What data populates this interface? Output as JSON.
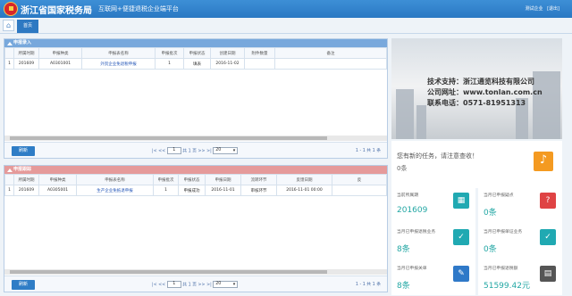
{
  "header": {
    "title": "浙江省国家税务局",
    "subtitle": "互联网+便捷退税企业端平台",
    "user": "测试企业",
    "logout": "[退出]"
  },
  "tabs": {
    "home": "⌂",
    "active": "首页"
  },
  "panel1": {
    "title": "申报录入",
    "columns": [
      "",
      "所属时期",
      "申报种类",
      "申报表名称",
      "申报批次",
      "申报状态",
      "创建日期",
      "附件数量",
      "备注"
    ],
    "rows": [
      [
        "1",
        "201609",
        "A0301001",
        "外贸企业免退税申报",
        "1",
        "填表",
        "2016-11-02",
        "",
        ""
      ]
    ],
    "refresh": "刷新",
    "pager": {
      "nav1": "|< <<",
      "page": "1",
      "total": "共 1 页",
      "nav2": ">> >|",
      "size": "20"
    },
    "count": "1 - 1 共 1 条"
  },
  "panel2": {
    "title": "申报跟踪",
    "columns": [
      "",
      "所属时期",
      "申报种类",
      "申报表名称",
      "申报批次",
      "申报状态",
      "申报日期",
      "流转环节",
      "反馈日期",
      "反"
    ],
    "rows": [
      [
        "1",
        "201609",
        "A0305001",
        "生产企业免抵退申报",
        "1",
        "申报成功",
        "2016-11-01",
        "审核环节",
        "2016-11-01 00:00",
        ""
      ]
    ],
    "refresh": "刷新",
    "pager": {
      "nav1": "|< <<",
      "page": "1",
      "total": "共 1 页",
      "nav2": ">> >|",
      "size": "20"
    },
    "count": "1 - 1 共 1 条"
  },
  "banner": {
    "line1": "技术支持：浙江通览科技有限公司",
    "line2": "公司网址：www.tonlan.com.cn",
    "line3": "联系电话：0571-81951313"
  },
  "task": {
    "title": "您有新的任务，请注意查收！",
    "count": "0条"
  },
  "cards": [
    {
      "label": "当前所属期",
      "value": "201609",
      "color": "#20a9b2",
      "icon": "▦"
    },
    {
      "label": "当月已申报疑点",
      "value": "0条",
      "color": "#df4344",
      "icon": "?"
    },
    {
      "label": "当月已申报退税业务",
      "value": "8条",
      "color": "#20a9b2",
      "icon": "✓"
    },
    {
      "label": "当月已申报单证业务",
      "value": "0条",
      "color": "#20a9b2",
      "icon": "✓"
    },
    {
      "label": "当月已申报关单",
      "value": "8条",
      "color": "#2f79c8",
      "icon": "✎"
    },
    {
      "label": "当月已申报退税额",
      "value": "51599.42元",
      "color": "#555555",
      "icon": "▤"
    }
  ]
}
